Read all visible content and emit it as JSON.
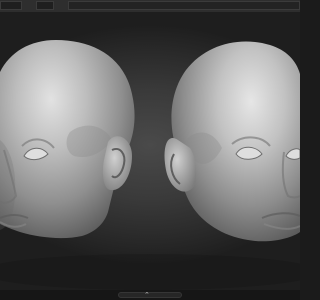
{
  "app": {
    "top_bar_fields": [
      "",
      "",
      ""
    ],
    "bottom_handle_icon": "chevron-updown-icon"
  },
  "scene": {
    "subject": [
      "head-sculpt-left",
      "head-sculpt-right"
    ],
    "background": "#3a3a3a"
  }
}
